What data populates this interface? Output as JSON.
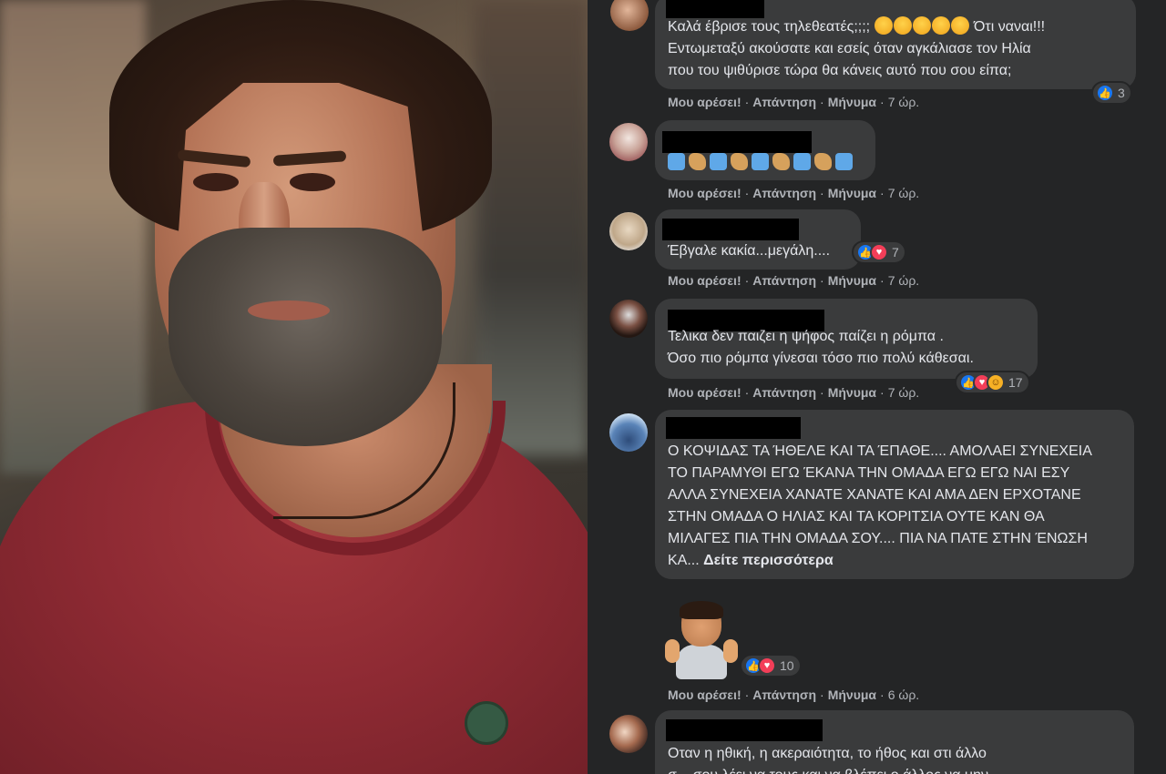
{
  "comments": [
    {
      "text_lines": [
        "Καλά έβρισε τους τηλεθεατές;;;;",
        "Εντωμεταξύ ακούσατε και εσείς όταν αγκάλιασε τον Ηλία",
        "που του ψιθύρισε τώρα θα κάνεις αυτό που σου είπα;"
      ],
      "text_after_emojis": "Ότι ναναι!!!",
      "reaction_count": "3",
      "actions": {
        "like": "Μου αρέσει!",
        "reply": "Απάντηση",
        "message": "Μήνυμα",
        "time": "7 ώρ."
      }
    },
    {
      "reaction_count": "",
      "actions": {
        "like": "Μου αρέσει!",
        "reply": "Απάντηση",
        "message": "Μήνυμα",
        "time": "7 ώρ."
      }
    },
    {
      "text_lines": [
        "Έβγαλε κακία...μεγάλη...."
      ],
      "reaction_count": "7",
      "actions": {
        "like": "Μου αρέσει!",
        "reply": "Απάντηση",
        "message": "Μήνυμα",
        "time": "7 ώρ."
      }
    },
    {
      "text_lines": [
        "Τελικα δεν παιζει η ψήφος παίζει η ρόμπα .",
        "Όσο πιο ρόμπα γίνεσαι τόσο πιο πολύ κάθεσαι."
      ],
      "reaction_count": "17",
      "actions": {
        "like": "Μου αρέσει!",
        "reply": "Απάντηση",
        "message": "Μήνυμα",
        "time": "7 ώρ."
      }
    },
    {
      "text_lines": [
        "Ο ΚΟΨΙΔΑΣ ΤΑ ΉΘΕΛΕ ΚΑΙ ΤΑ ΈΠΑΘΕ.... ΑΜΟΛΑΕΙ ΣΥΝΕΧΕΙΑ",
        "ΤΟ ΠΑΡΑΜΥΘΙ ΕΓΩ ΈΚΑΝΑ ΤΗΝ ΟΜΑΔΑ ΕΓΩ ΕΓΩ ΝΑΙ ΕΣΥ",
        "ΑΛΛΑ ΣΥΝΕΧΕΙΑ ΧΑΝΑΤΕ ΧΑΝΑΤΕ ΚΑΙ ΑΜΑ ΔΕΝ ΕΡΧΟΤΑΝΕ",
        "ΣΤΗΝ ΟΜΑΔΑ Ο ΗΛΙΑΣ ΚΑΙ ΤΑ ΚΟΡΙΤΣΙΑ ΟΥΤΕ ΚΑΝ ΘΑ",
        "ΜΙΛΑΓΕΣ ΠΙΑ ΤΗΝ ΟΜΑΔΑ ΣΟΥ.... ΠΙΑ ΝΑ ΠΑΤΕ ΣΤΗΝ ΈΝΩΣΗ"
      ],
      "last_line_prefix": "ΚΑ...",
      "see_more": "Δείτε περισσότερα"
    },
    {
      "sticker": "thumbs-up-avatar-sticker",
      "reaction_count": "10",
      "actions": {
        "like": "Μου αρέσει!",
        "reply": "Απάντηση",
        "message": "Μήνυμα",
        "time": "6 ώρ."
      }
    },
    {
      "text_lines": [
        "Οταν η ηθική, η ακεραιότητα, το ήθος και στι άλλο",
        "σ... σου λέει να τους και να βλέπει ο άλλος να μην"
      ]
    }
  ],
  "colors": {
    "panel_bg": "#242526",
    "bubble_bg": "#3a3b3c",
    "text": "#e4e6eb",
    "secondary_text": "#b0b3b8",
    "like_blue": "#1877f2",
    "love_red": "#f33e58"
  }
}
